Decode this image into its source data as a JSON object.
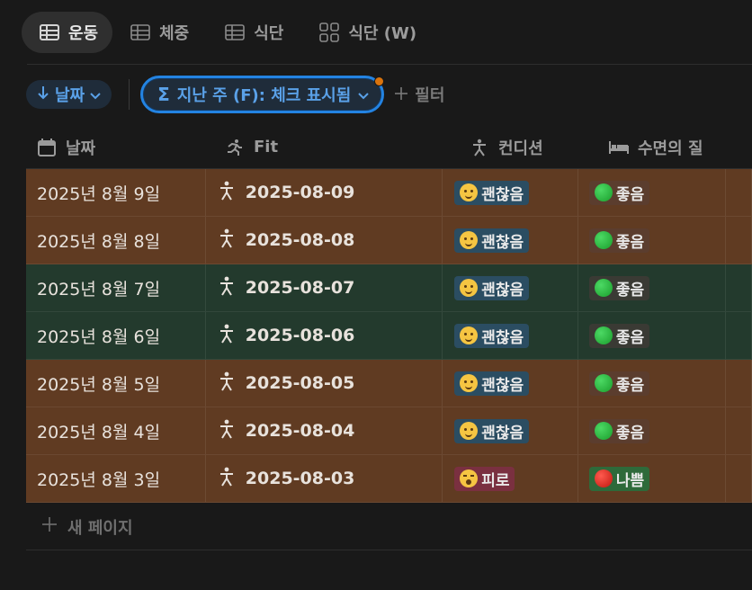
{
  "tabs": [
    {
      "label": "운동",
      "icon": "table-icon",
      "active": true
    },
    {
      "label": "체중",
      "icon": "table-icon",
      "active": false
    },
    {
      "label": "식단",
      "icon": "table-icon",
      "active": false
    },
    {
      "label": "식단 (W)",
      "icon": "gallery-icon",
      "active": false
    }
  ],
  "filters": {
    "sort_label": "날짜",
    "filter_label": "지난 주 (F): 체크 표시됨",
    "add_filter_label": "필터"
  },
  "columns": [
    {
      "label": "날짜",
      "icon": "calendar-icon"
    },
    {
      "label": "Fit",
      "icon": "running-person-icon"
    },
    {
      "label": "컨디션",
      "icon": "person-icon"
    },
    {
      "label": "수면의 질",
      "icon": "bed-icon"
    }
  ],
  "rows": [
    {
      "date": "2025년 8월 9일",
      "fit": "2025-08-09",
      "condition": "괜찮음",
      "sleep": "좋음",
      "color": "orange"
    },
    {
      "date": "2025년 8월 8일",
      "fit": "2025-08-08",
      "condition": "괜찮음",
      "sleep": "좋음",
      "color": "orange"
    },
    {
      "date": "2025년 8월 7일",
      "fit": "2025-08-07",
      "condition": "괜찮음",
      "sleep": "좋음",
      "color": "green"
    },
    {
      "date": "2025년 8월 6일",
      "fit": "2025-08-06",
      "condition": "괜찮음",
      "sleep": "좋음",
      "color": "green"
    },
    {
      "date": "2025년 8월 5일",
      "fit": "2025-08-05",
      "condition": "괜찮음",
      "sleep": "좋음",
      "color": "orange"
    },
    {
      "date": "2025년 8월 4일",
      "fit": "2025-08-04",
      "condition": "괜찮음",
      "sleep": "좋음",
      "color": "orange"
    },
    {
      "date": "2025년 8월 3일",
      "fit": "2025-08-03",
      "condition": "피로",
      "sleep": "나쁨",
      "color": "orange"
    }
  ],
  "new_page_label": "새 페이지",
  "colors": {
    "accent": "#2383e2",
    "row_orange": "#603b22",
    "row_green": "#233a2d"
  }
}
